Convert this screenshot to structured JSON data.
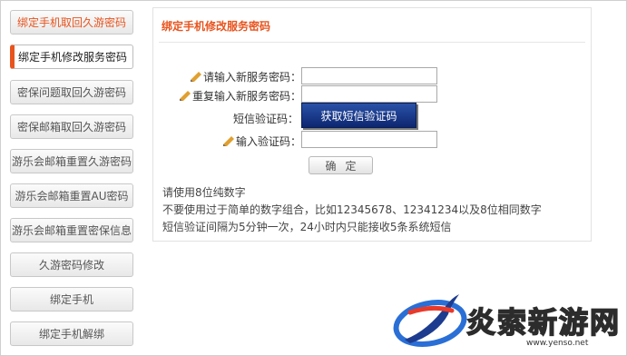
{
  "sidebar": {
    "items": [
      {
        "label": "绑定手机取回久游密码"
      },
      {
        "label": "绑定手机修改服务密码"
      },
      {
        "label": "密保问题取回久游密码"
      },
      {
        "label": "密保邮箱取回久游密码"
      },
      {
        "label": "游乐会邮箱重置久游密码"
      },
      {
        "label": "游乐会邮箱重置AU密码"
      },
      {
        "label": "游乐会邮箱重置密保信息"
      },
      {
        "label": "久游密码修改"
      },
      {
        "label": "绑定手机"
      },
      {
        "label": "绑定手机解绑"
      }
    ]
  },
  "main": {
    "title": "绑定手机修改服务密码",
    "form": {
      "new_password_label": "请输入新服务密码：",
      "repeat_password_label": "重复输入新服务密码：",
      "sms_code_label": "短信验证码：",
      "sms_button_label": "获取短信验证码",
      "input_code_label": "输入验证码：",
      "confirm_label": "确定"
    },
    "notes": [
      "请使用8位纯数字",
      "不要使用过于简单的数字组合，比如12345678、12341234以及8位相同数字",
      "短信验证间隔为5分钟一次，24小时内只能接收5条系统短信"
    ]
  },
  "watermark": {
    "text": "炎索新游网",
    "url": "www.yenso.net"
  },
  "colors": {
    "accent": "#e8541e",
    "sms_button": "#1a3a8a"
  }
}
